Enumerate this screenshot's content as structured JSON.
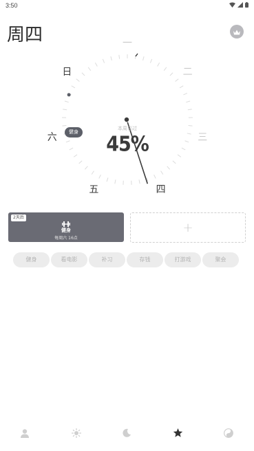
{
  "status_bar": {
    "time": "3:50"
  },
  "header": {
    "title": "周四",
    "crown_icon": "crown-icon"
  },
  "dial": {
    "days": [
      {
        "key": "mon",
        "label": "一",
        "faded": true
      },
      {
        "key": "tue",
        "label": "二",
        "faded": true
      },
      {
        "key": "wed",
        "label": "三",
        "faded": true
      },
      {
        "key": "thu",
        "label": "四",
        "faded": false
      },
      {
        "key": "fri",
        "label": "五",
        "faded": false
      },
      {
        "key": "sat",
        "label": "六",
        "faded": false
      },
      {
        "key": "sun",
        "label": "日",
        "faded": false
      }
    ],
    "caption": "本周已过",
    "percent": "45%",
    "progress_fraction": 0.45,
    "event_bubble": "健身"
  },
  "cards": {
    "habit": {
      "countdown_tag": "2天后",
      "icon": "dumbbell-icon",
      "name": "健身",
      "schedule": "每周六 16点"
    },
    "add": {
      "label": "+"
    }
  },
  "chips": [
    "健身",
    "看电影",
    "补习",
    "存钱",
    "打游戏",
    "聚会"
  ],
  "bottom_nav": [
    {
      "key": "profile",
      "icon": "person-icon"
    },
    {
      "key": "day",
      "icon": "sun-icon"
    },
    {
      "key": "night",
      "icon": "moon-icon"
    },
    {
      "key": "favorites",
      "icon": "star-icon",
      "active": true
    },
    {
      "key": "theme",
      "icon": "yin-yang-icon"
    }
  ],
  "colors": {
    "card_bg": "#6a6b74",
    "chip_bg": "#ececec",
    "hand": "#3b3b3b",
    "active_nav": "#333333",
    "inactive_nav": "#cfcfcf"
  }
}
